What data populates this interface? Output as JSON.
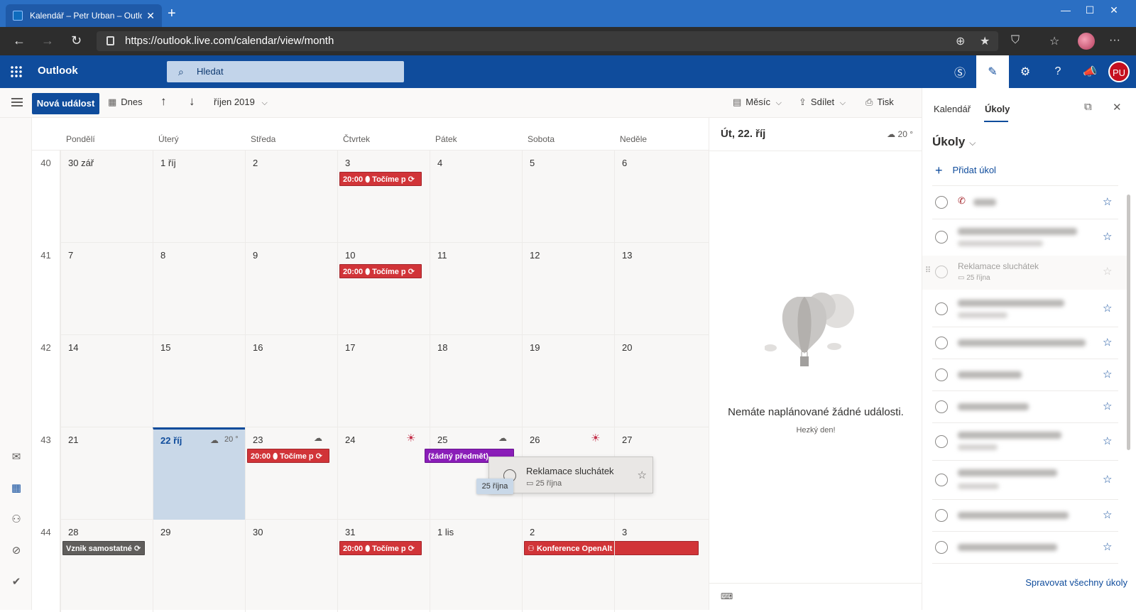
{
  "browser": {
    "tab_title": "Kalendář – Petr Urban – Outlook",
    "url": "https://outlook.live.com/calendar/view/month"
  },
  "header": {
    "app_name": "Outlook",
    "search_placeholder": "Hledat",
    "avatar_initials": "PU"
  },
  "toolbar": {
    "new_event": "Nová událost",
    "today": "Dnes",
    "month_label": "říjen 2019",
    "view": "Měsíc",
    "share": "Sdílet",
    "print": "Tisk"
  },
  "calendar": {
    "day_names": [
      "Pondělí",
      "Úterý",
      "Středa",
      "Čtvrtek",
      "Pátek",
      "Sobota",
      "Neděle"
    ],
    "weeks": [
      {
        "num": "40",
        "days": [
          "30 zář",
          "1 říj",
          "2",
          "3",
          "4",
          "5",
          "6"
        ]
      },
      {
        "num": "41",
        "days": [
          "7",
          "8",
          "9",
          "10",
          "11",
          "12",
          "13"
        ]
      },
      {
        "num": "42",
        "days": [
          "14",
          "15",
          "16",
          "17",
          "18",
          "19",
          "20"
        ]
      },
      {
        "num": "43",
        "days": [
          "21",
          "22 říj",
          "23",
          "24",
          "25",
          "26",
          "27"
        ]
      },
      {
        "num": "44",
        "days": [
          "28",
          "29",
          "30",
          "31",
          "1 lis",
          "2",
          "3"
        ]
      }
    ],
    "today_weather": "20 °",
    "events": {
      "tocime_time": "20:00",
      "tocime_title": "Točíme p",
      "no_subject": "(žádný předmět)",
      "vznik": "Vznik samostatné",
      "konference": "Konference OpenAlt"
    },
    "drag_ghost": {
      "title": "Reklamace sluchátek",
      "due": "25 října",
      "tooltip": "25 října"
    }
  },
  "agenda": {
    "date": "Út, 22. říj",
    "weather": "20 °",
    "empty_text": "Nemáte naplánované žádné události.",
    "greeting": "Hezký den!"
  },
  "tasks_pane": {
    "tab_calendar": "Kalendář",
    "tab_tasks": "Úkoly",
    "heading": "Úkoly",
    "add_task": "Přidat úkol",
    "dragged_task_title": "Reklamace sluchátek",
    "dragged_task_due": "25 října",
    "manage_all": "Spravovat všechny úkoly"
  },
  "colors": {
    "brand": "#0f4c9c",
    "event_red": "#d13438",
    "event_purple": "#8a1db8",
    "event_gray": "#605e5c",
    "today_cell": "#c9d8e8"
  }
}
